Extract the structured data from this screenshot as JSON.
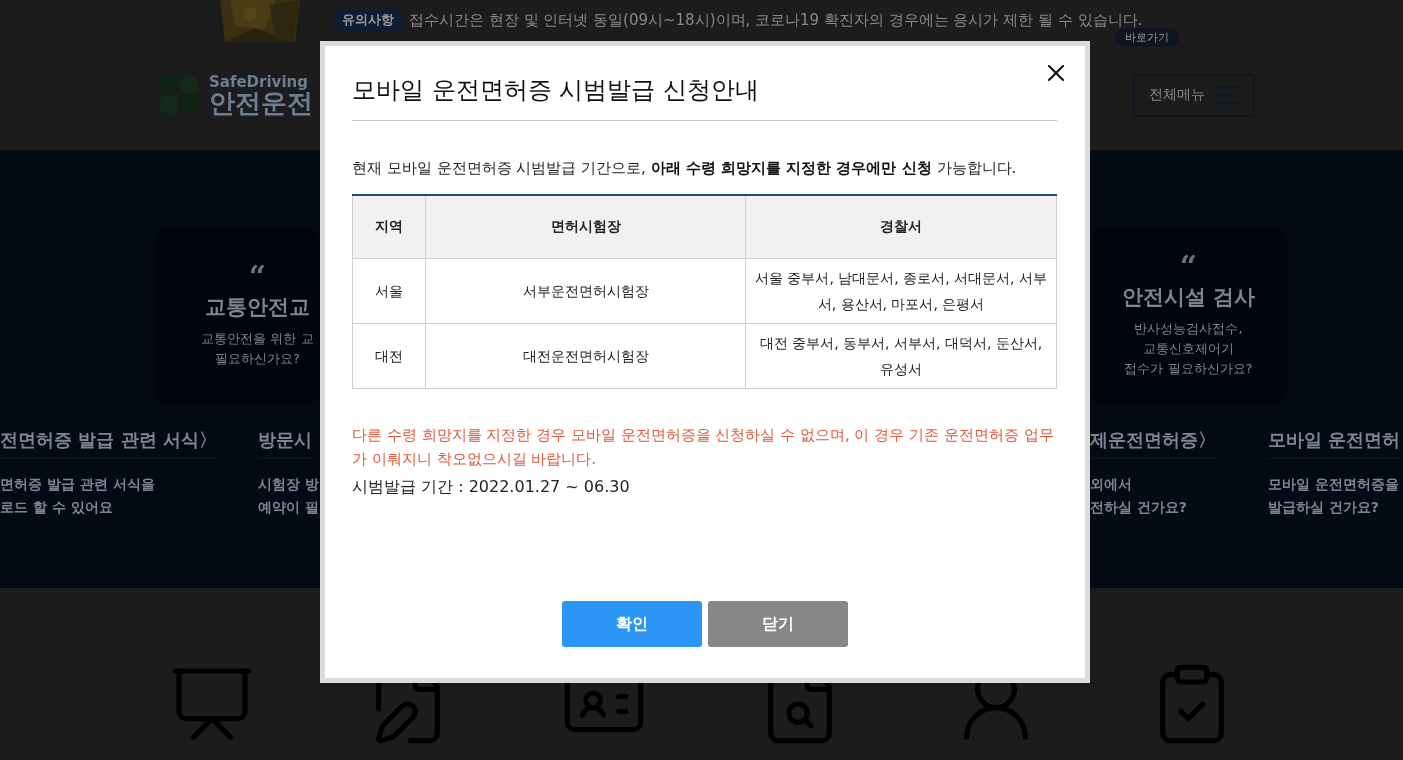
{
  "notice": {
    "badge": "유의사항",
    "text": "접수시간은 현장 및 인터넷 동일(09시~18시)이며, 코로나19 확진자의 경우에는 응시가 제한 될 수 있습니다.",
    "link": "바로가기"
  },
  "header": {
    "logo_top": "SafeDriving",
    "logo_main": "안전운전",
    "menu_button": "전체메뉴"
  },
  "hero": {
    "cards": [
      {
        "quote": "“",
        "title": "교통안전교",
        "lines": [
          "교통안전을 위한 교",
          "필요하신가요?"
        ]
      },
      {
        "quote": "“",
        "title": "안전시설 검사",
        "lines": [
          "반사성능검사접수,",
          "교통신호제어기",
          "접수가 필요하신가요?"
        ]
      }
    ],
    "links": [
      {
        "title": "전면허증 발급 관련 서식〉",
        "lines": [
          "면허증 발급 관련 서식을",
          "로드 할 수 있어요"
        ]
      },
      {
        "title": "방문시",
        "lines": [
          "시험장 방",
          "예약이 필"
        ]
      },
      {
        "title": "제운전면허증〉",
        "lines": [
          "외에서",
          "전하실 건가요?"
        ]
      },
      {
        "title": "모바일 운전면허",
        "lines": [
          "모바일 운전면허증을",
          "발급하실 건가요?"
        ]
      }
    ]
  },
  "modal": {
    "title": "모바일 운전면허증 시범발급 신청안내",
    "intro": "현재 모바일 운전면허증 시범발급 기간으로,  **아래 수령 희망지를 지정한 경우에만 신청** 가능합니다.",
    "table": {
      "columns": [
        "지역",
        "면허시험장",
        "경찰서"
      ],
      "rows": [
        [
          "서울",
          "서부운전면허시험장",
          "서울 중부서, 남대문서, 종로서, 서대문서, 서부서, 용산서, 마포서, 은평서"
        ],
        [
          "대전",
          "대전운전면허시험장",
          "대전 중부서, 동부서, 서부서, 대덕서, 둔산서, 유성서"
        ]
      ]
    },
    "warning": "다른 수령 희망지를 지정한 경우 모바일 운전면허증을 신청하실 수 없으며,  이 경우 기존 운전면허증 업무가 이뤄지니 착오없으시길 바랍니다.",
    "period": "시범발급 기간 : 2022.01.27 ~ 06.30",
    "buttons": [
      {
        "label": "확인",
        "kind": "primary"
      },
      {
        "label": "닫기",
        "kind": "secondary"
      }
    ]
  }
}
